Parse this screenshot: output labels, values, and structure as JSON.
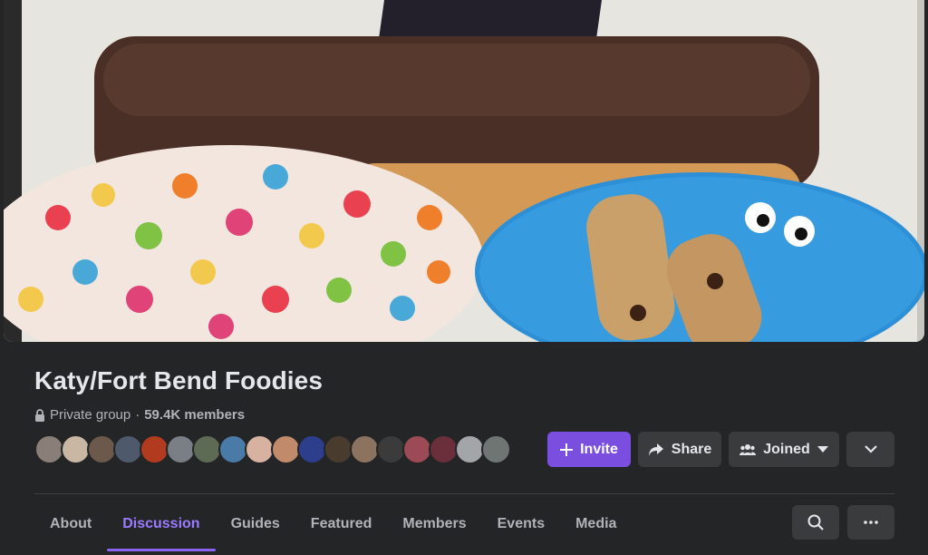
{
  "group": {
    "name": "Katy/Fort Bend Foodies",
    "privacy": "Private group",
    "separator": "·",
    "members": "59.4K members"
  },
  "actions": {
    "invite": "Invite",
    "share": "Share",
    "joined": "Joined"
  },
  "tabs": [
    "About",
    "Discussion",
    "Guides",
    "Featured",
    "Members",
    "Events",
    "Media"
  ],
  "active_tab": "Discussion",
  "colors": {
    "background": "#242526",
    "accent": "#7a4fe0",
    "active_tab": "#9b7bff",
    "button": "#3a3b3c"
  },
  "icons": [
    "lock-icon",
    "plus-icon",
    "share-arrow-icon",
    "group-people-icon",
    "caret-down-icon",
    "chevron-down-icon",
    "search-icon",
    "more-dots-icon"
  ],
  "member_avatar_colors": [
    "#8a7f78",
    "#c9b7a4",
    "#6b5a4c",
    "#4e5a6b",
    "#b23a1e",
    "#7a7f86",
    "#5d6b55",
    "#4a7aa8",
    "#d7b2a0",
    "#c08a6b",
    "#2d3f8c",
    "#4a3b2f",
    "#8c7360",
    "#3b3b3b",
    "#9c4a55",
    "#6a2f3a",
    "#a3a6a8",
    "#6e7572"
  ]
}
